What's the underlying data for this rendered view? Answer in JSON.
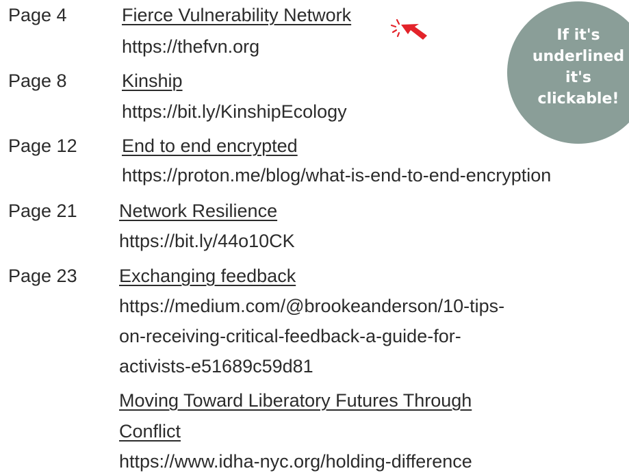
{
  "badge": {
    "lines": [
      "If it's",
      "underlined",
      "it's",
      "clickable!"
    ],
    "color": "#8a9e98"
  },
  "cursor_icon": "pointer-hand-click-icon",
  "entries": [
    {
      "page": "Page 4",
      "links": [
        {
          "title": "Fierce Vulnerability Network",
          "url_lines": [
            "https://thefvn.org"
          ]
        }
      ]
    },
    {
      "page": "Page 8",
      "links": [
        {
          "title": "Kinship",
          "url_lines": [
            "https://bit.ly/KinshipEcology"
          ]
        }
      ]
    },
    {
      "page": "Page 12",
      "links": [
        {
          "title": "End to end encrypted",
          "url_lines": [
            "https://proton.me/blog/what-is-end-to-end-encryption"
          ]
        }
      ]
    },
    {
      "page": "Page 21",
      "links": [
        {
          "title": "Network Resilience",
          "url_lines": [
            "https://bit.ly/44o10CK"
          ]
        }
      ]
    },
    {
      "page": "Page 23",
      "links": [
        {
          "title": "Exchanging feedback",
          "url_lines": [
            "https://medium.com/@brookeanderson/10-tips-",
            "on-receiving-critical-feedback-a-guide-for-",
            "activists-e51689c59d81"
          ]
        },
        {
          "title_lines": [
            "Moving Toward Liberatory Futures Through",
            "Conflict"
          ],
          "url_lines": [
            "https://www.idha-nyc.org/holding-difference"
          ]
        }
      ]
    }
  ]
}
